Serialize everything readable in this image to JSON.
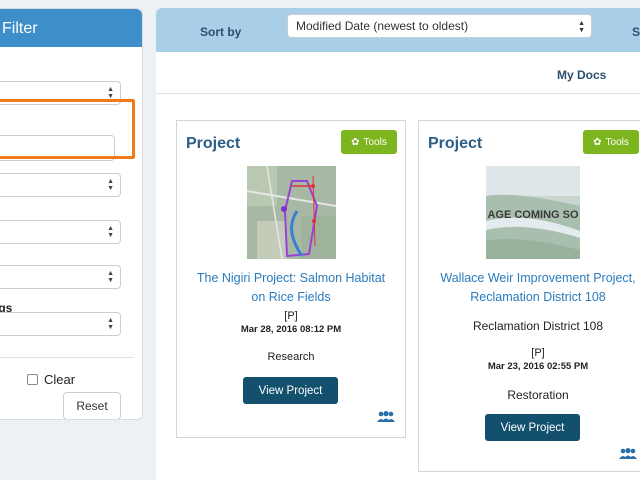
{
  "filter": {
    "title": "Filter",
    "label_fragment": "ngs",
    "clear_label": "Clear",
    "reset_label": "Reset"
  },
  "sort": {
    "label": "Sort by",
    "selected": "Modified Date (newest to oldest)",
    "right_fragment": "S"
  },
  "tabs": {
    "my_docs": "My Docs"
  },
  "cards": [
    {
      "heading": "Project",
      "tools_label": "Tools",
      "title_line1": "The Nigiri Project: Salmon Habitat",
      "title_line2": "on Rice Fields",
      "subtitle": "",
      "flag": "[P]",
      "date": "Mar 28, 2016 08:12 PM",
      "category": "Research",
      "view_label": "View Project"
    },
    {
      "heading": "Project",
      "tools_label": "Tools",
      "title_line1": "Wallace Weir Improvement Project,",
      "title_line2": "Reclamation District 108",
      "subtitle": "Reclamation District 108",
      "flag": "[P]",
      "date": "Mar 23, 2016 02:55 PM",
      "category": "Restoration",
      "view_label": "View Project",
      "image_text": "AGE COMING SO"
    }
  ],
  "colors": {
    "accent": "#3d8ec9",
    "highlight": "#f07a1a",
    "tools": "#7cb51e",
    "view_button": "#13506e",
    "link": "#2a7bbd"
  }
}
